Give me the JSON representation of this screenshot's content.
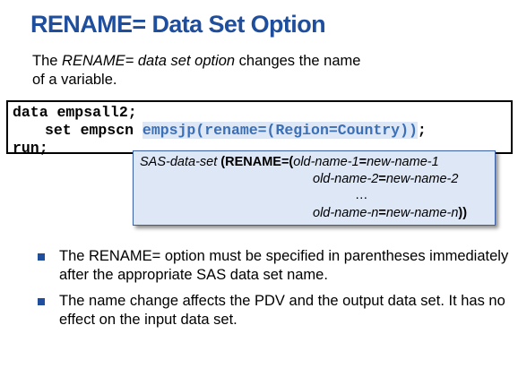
{
  "title": "RENAME= Data Set Option",
  "intro": {
    "part1": "The ",
    "part2": "RENAME= data set option",
    "part3": " changes the name",
    "line2": "of a variable."
  },
  "code": {
    "line1": "data empsall2;",
    "line2_prefix": "set empscn ",
    "line2_highlight": "empsjp(rename=(Region=Country))",
    "line2_suffix": ";",
    "line3": "run;"
  },
  "syntax": {
    "dataset": "SAS-data-set",
    "kw": " (RENAME=(",
    "old1": "old-name-1",
    "eq1": "=",
    "new1": "new-name-1",
    "old2": "old-name-2",
    "eq2": "=",
    "new2": "new-name-2",
    "dots": "…",
    "oldn": "old-name-n",
    "eqn": "=",
    "newn": "new-name-n",
    "close": "))"
  },
  "bullets": [
    "The RENAME= option must be specified in parentheses immediately after the appropriate SAS data set name.",
    "The name change affects the PDV and the output data set. It has no effect on the input data set."
  ],
  "colors": {
    "title": "#1f4e9c",
    "highlight_text": "#3b6fb6",
    "highlight_bg": "#dde7f6",
    "bullet_marker": "#1f4e9c"
  }
}
